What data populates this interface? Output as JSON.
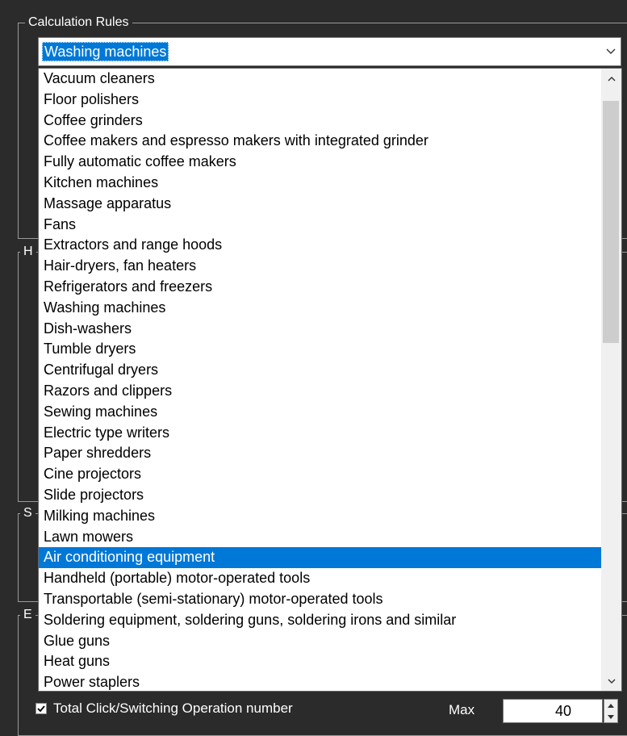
{
  "calculation_rules": {
    "title": "Calculation Rules",
    "selected_value": "Washing machines"
  },
  "background_groups": [
    {
      "title": "H"
    },
    {
      "title": "S"
    },
    {
      "title": "E"
    }
  ],
  "dropdown": {
    "highlighted_item": "Air conditioning equipment",
    "items": [
      "Vacuum cleaners",
      "Floor polishers",
      "Coffee grinders",
      "Coffee makers and espresso makers with integrated grinder",
      "Fully automatic coffee makers",
      "Kitchen machines",
      "Massage apparatus",
      "Fans",
      "Extractors and range hoods",
      "Hair-dryers, fan heaters",
      "Refrigerators and freezers",
      "Washing machines",
      "Dish-washers",
      "Tumble dryers",
      "Centrifugal dryers",
      "Razors and clippers",
      "Sewing machines",
      "Electric type writers",
      "Paper shredders",
      "Cine projectors",
      "Slide projectors",
      "Milking machines",
      "Lawn mowers",
      "Air conditioning equipment",
      "Handheld (portable) motor-operated tools",
      "Transportable (semi-stationary) motor-operated tools",
      "Soldering equipment, soldering guns, soldering irons and similar",
      "Glue guns",
      "Heat guns",
      "Power staplers"
    ]
  },
  "bottom_row": {
    "checkbox_label": "Total Click/Switching Operation  number",
    "checked": true,
    "max_label": "Max",
    "max_value": "40"
  },
  "colors": {
    "window_bg": "#2b2b2b",
    "selection": "#0078d7",
    "list_bg": "#ffffff"
  }
}
